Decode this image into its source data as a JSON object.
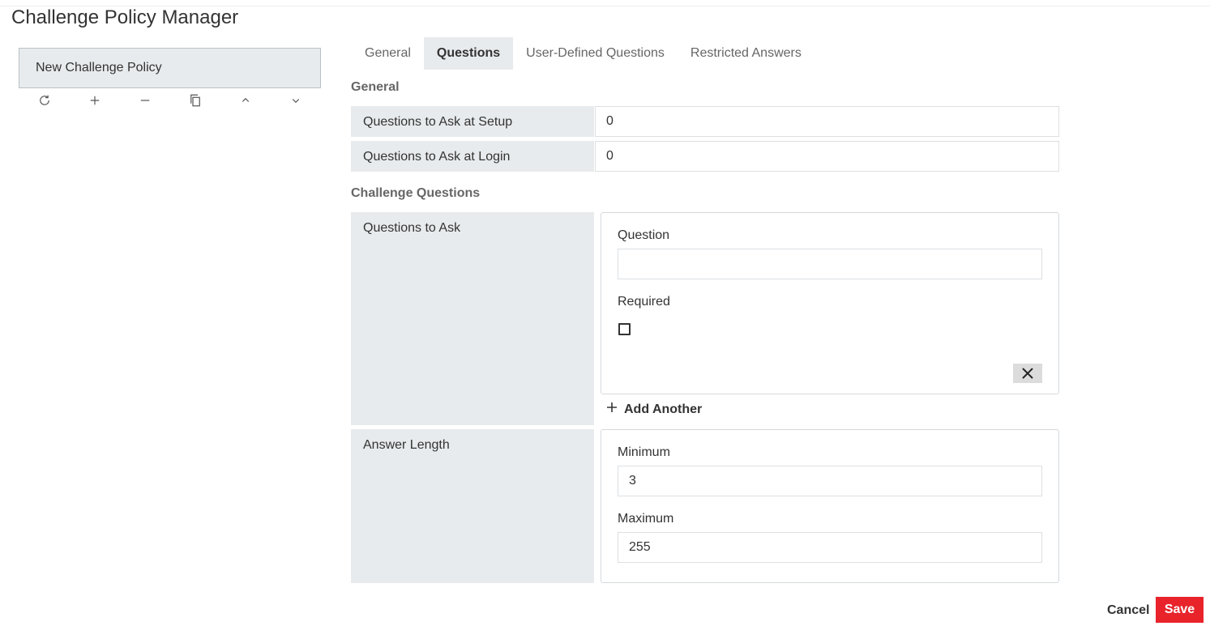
{
  "app": {
    "title": "Challenge Policy Manager"
  },
  "policy_list": {
    "items": [
      {
        "label": "New Challenge Policy"
      }
    ],
    "toolbar": [
      "refresh-icon",
      "plus-icon",
      "minus-icon",
      "copy-icon",
      "chevron-up-icon",
      "chevron-down-icon"
    ]
  },
  "tabs": [
    {
      "label": "General",
      "active": false
    },
    {
      "label": "Questions",
      "active": true
    },
    {
      "label": "User-Defined Questions",
      "active": false
    },
    {
      "label": "Restricted Answers",
      "active": false
    }
  ],
  "general": {
    "heading": "General",
    "setup_label": "Questions to Ask at Setup",
    "setup_value": "0",
    "login_label": "Questions to Ask at Login",
    "login_value": "0"
  },
  "challenge": {
    "heading": "Challenge Questions",
    "questions_label": "Questions to Ask",
    "question_field_label": "Question",
    "question_value": "",
    "required_label": "Required",
    "required_checked": false,
    "add_another_label": "Add Another",
    "answer_length_label": "Answer Length",
    "minimum_label": "Minimum",
    "minimum_value": "3",
    "maximum_label": "Maximum",
    "maximum_value": "255"
  },
  "footer": {
    "cancel_label": "Cancel",
    "save_label": "Save"
  },
  "colors": {
    "accent_save": "#e8232a",
    "label_bg": "#e8ebed"
  }
}
